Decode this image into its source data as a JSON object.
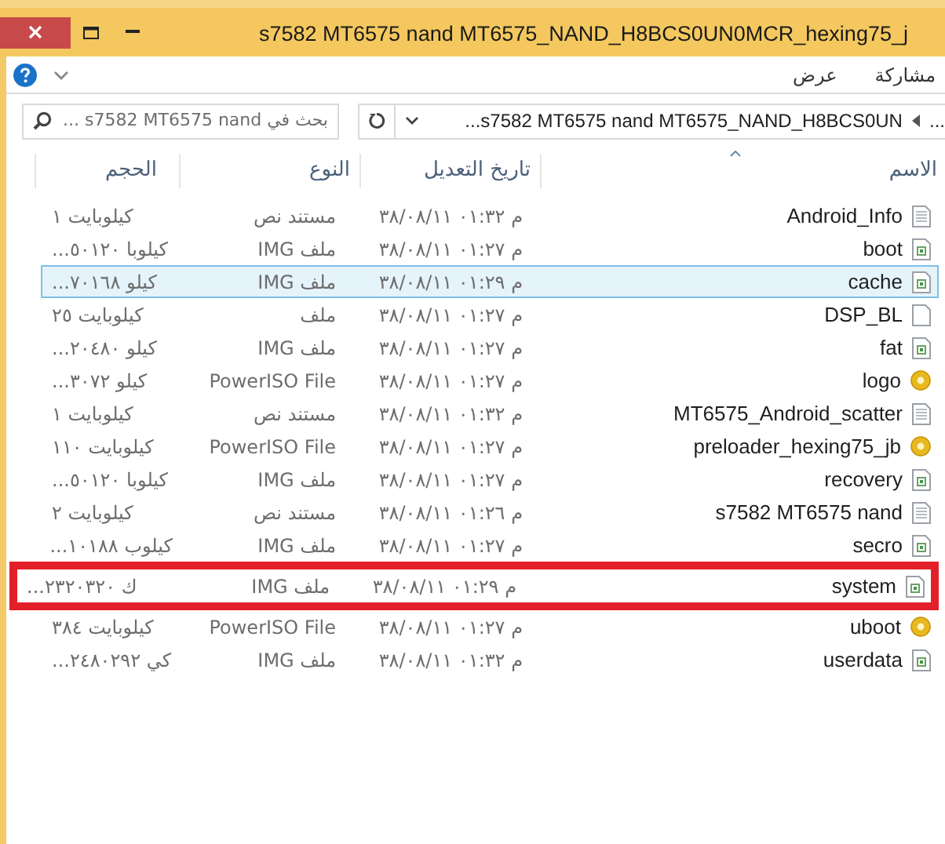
{
  "window": {
    "title": "s7582 MT6575 nand MT6575_NAND_H8BCS0UN0MCR_hexing75_j"
  },
  "ribbon": {
    "tabs": [
      "مشاركة",
      "عرض"
    ]
  },
  "address": {
    "overflow": "...",
    "path": "s7582 MT6575 nand MT6575_NAND_H8BCS0UN..."
  },
  "search": {
    "placeholder": "بحث في s7582 MT6575 nand ..."
  },
  "table": {
    "columns": [
      "الاسم",
      "تاريخ التعديل",
      "النوع",
      "الحجم"
    ],
    "rows": [
      {
        "name": "Android_Info",
        "kind": "text",
        "modified": "م ٠١:٣٢ ٣٨/٠٨/١١",
        "type": "مستند نص",
        "size": "كيلوبايت ١",
        "selected": false,
        "annotated": false
      },
      {
        "name": "boot",
        "kind": "image",
        "modified": "م ٠١:٢٧ ٣٨/٠٨/١١",
        "type": "ملف IMG",
        "size": "كيلوبا ٥٠١٢٠...",
        "selected": false,
        "annotated": false
      },
      {
        "name": "cache",
        "kind": "image",
        "modified": "م ٠١:٢٩ ٣٨/٠٨/١١",
        "type": "ملف IMG",
        "size": "كيلو ٧٠١٦٨...",
        "selected": true,
        "annotated": false
      },
      {
        "name": "DSP_BL",
        "kind": "file",
        "modified": "م ٠١:٢٧ ٣٨/٠٨/١١",
        "type": "ملف",
        "size": "كيلوبايت ٢٥",
        "selected": false,
        "annotated": false
      },
      {
        "name": "fat",
        "kind": "image",
        "modified": "م ٠١:٢٧ ٣٨/٠٨/١١",
        "type": "ملف IMG",
        "size": "كيلو ٢٠٤٨٠...",
        "selected": false,
        "annotated": false
      },
      {
        "name": "logo",
        "kind": "disc",
        "modified": "م ٠١:٢٧ ٣٨/٠٨/١١",
        "type": "PowerISO File",
        "size": "كيلو ٣٠٧٢...",
        "selected": false,
        "annotated": false
      },
      {
        "name": "MT6575_Android_scatter",
        "kind": "text",
        "modified": "م ٠١:٣٢ ٣٨/٠٨/١١",
        "type": "مستند نص",
        "size": "كيلوبايت ١",
        "selected": false,
        "annotated": false
      },
      {
        "name": "preloader_hexing75_jb",
        "kind": "disc",
        "modified": "م ٠١:٢٧ ٣٨/٠٨/١١",
        "type": "PowerISO File",
        "size": "كيلوبايت ١١٠",
        "selected": false,
        "annotated": false
      },
      {
        "name": "recovery",
        "kind": "image",
        "modified": "م ٠١:٢٧ ٣٨/٠٨/١١",
        "type": "ملف IMG",
        "size": "كيلوبا ٥٠١٢٠...",
        "selected": false,
        "annotated": false
      },
      {
        "name": "s7582 MT6575 nand",
        "kind": "text",
        "modified": "م ٠١:٢٦ ٣٨/٠٨/١١",
        "type": "مستند نص",
        "size": "كيلوبايت ٢",
        "selected": false,
        "annotated": false
      },
      {
        "name": "secro",
        "kind": "image",
        "modified": "م ٠١:٢٧ ٣٨/٠٨/١١",
        "type": "ملف IMG",
        "size": "كيلوب ١٠١٨٨...",
        "selected": false,
        "annotated": false
      },
      {
        "name": "system",
        "kind": "image",
        "modified": "م ٠١:٢٩ ٣٨/٠٨/١١",
        "type": "ملف IMG",
        "size": "ك ٢٣٢٠٣٢٠...",
        "selected": false,
        "annotated": true
      },
      {
        "name": "uboot",
        "kind": "disc",
        "modified": "م ٠١:٢٧ ٣٨/٠٨/١١",
        "type": "PowerISO File",
        "size": "كيلوبايت ٣٨٤",
        "selected": false,
        "annotated": false
      },
      {
        "name": "userdata",
        "kind": "image",
        "modified": "م ٠١:٣٢ ٣٨/٠٨/١١",
        "type": "ملف IMG",
        "size": "كي ٢٤٨٠٢٩٢...",
        "selected": false,
        "annotated": false
      }
    ]
  }
}
